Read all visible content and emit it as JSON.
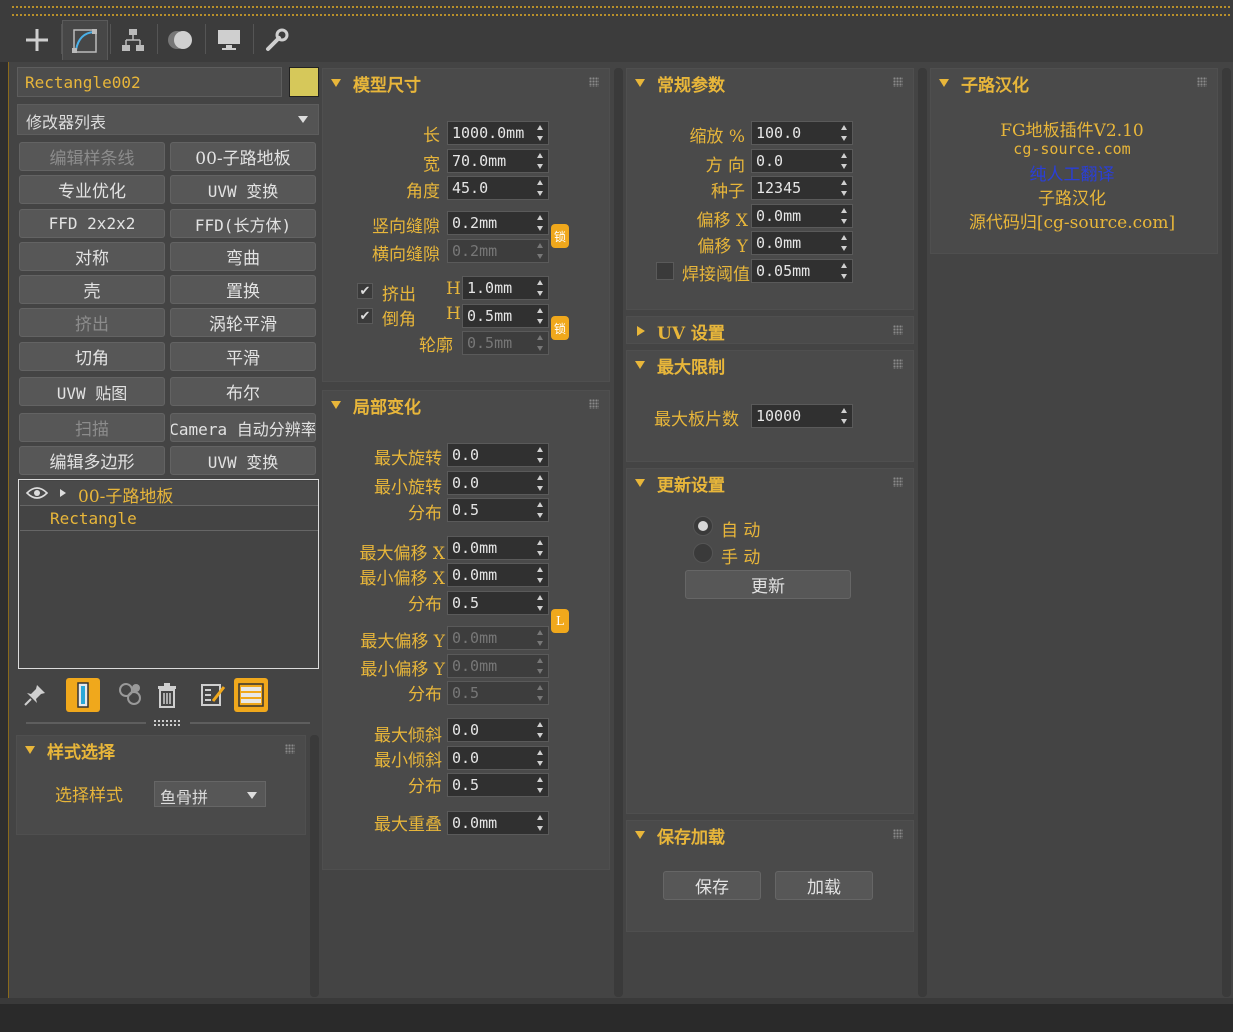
{
  "toolbar": {
    "tabs": [
      {
        "name": "create-tab",
        "icon": "plus-icon"
      },
      {
        "name": "modify-tab",
        "icon": "modify-curve-icon"
      },
      {
        "name": "hierarchy-tab",
        "icon": "hierarchy-icon"
      },
      {
        "name": "motion-tab",
        "icon": "motion-circle-icon"
      },
      {
        "name": "display-tab",
        "icon": "monitor-icon"
      },
      {
        "name": "utilities-tab",
        "icon": "wrench-icon"
      }
    ]
  },
  "object": {
    "name": "Rectangle002",
    "color": "#d6c85a"
  },
  "modifier_list": {
    "label": "修改器列表"
  },
  "modifier_buttons": [
    "编辑样条线",
    "00-子路地板",
    "专业优化",
    "UVW 变换",
    "FFD 2x2x2",
    "FFD(长方体)",
    "对称",
    "弯曲",
    "壳",
    "置换",
    "挤出",
    "涡轮平滑",
    "切角",
    "平滑",
    "UVW 贴图",
    "布尔",
    "扫描",
    "Camera 自动分辨率",
    "编辑多边形",
    "UVW 变换"
  ],
  "stack": {
    "items": [
      "00-子路地板",
      "Rectangle"
    ]
  },
  "style_select": {
    "title": "样式选择",
    "label": "选择样式",
    "value": "鱼骨拼"
  },
  "model_size": {
    "title": "模型尺寸",
    "length_label": "长",
    "length": "1000.0mm",
    "width_label": "宽",
    "width": "70.0mm",
    "angle_label": "角度",
    "angle": "45.0",
    "vgap_label": "竖向缝隙",
    "vgap": "0.2mm",
    "hgap_label": "横向缝隙",
    "hgap": "0.2mm",
    "lock1": "锁",
    "extrude_label": "挤出",
    "extrude_h": "H",
    "extrude": "1.0mm",
    "chamfer_label": "倒角",
    "chamfer_h": "H",
    "chamfer": "0.5mm",
    "lock2": "锁",
    "outline_label": "轮廓",
    "outline": "0.5mm"
  },
  "local_change": {
    "title": "局部变化",
    "max_rot_label": "最大旋转",
    "max_rot": "0.0",
    "min_rot_label": "最小旋转",
    "min_rot": "0.0",
    "dist1_label": "分布",
    "dist1": "0.5",
    "max_offx_label": "最大偏移 X",
    "max_offx": "0.0mm",
    "min_offx_label": "最小偏移 X",
    "min_offx": "0.0mm",
    "dist2_label": "分布",
    "dist2": "0.5",
    "lock_l": "L",
    "max_offy_label": "最大偏移 Y",
    "max_offy": "0.0mm",
    "min_offy_label": "最小偏移 Y",
    "min_offy": "0.0mm",
    "dist3_label": "分布",
    "dist3": "0.5",
    "max_tilt_label": "最大倾斜",
    "max_tilt": "0.0",
    "min_tilt_label": "最小倾斜",
    "min_tilt": "0.0",
    "dist4_label": "分布",
    "dist4": "0.5",
    "max_overlap_label": "最大重叠",
    "max_overlap": "0.0mm"
  },
  "general": {
    "title": "常规参数",
    "scale_label": "缩放 %",
    "scale": "100.0",
    "dir_label": "方 向",
    "dir": "0.0",
    "seed_label": "种子",
    "seed": "12345",
    "offx_label": "偏移 X",
    "offx": "0.0mm",
    "offy_label": "偏移 Y",
    "offy": "0.0mm",
    "weld_label": "焊接阈值",
    "weld": "0.05mm"
  },
  "uv": {
    "title": "UV 设置"
  },
  "max_limit": {
    "title": "最大限制",
    "label": "最大板片数",
    "value": "10000"
  },
  "update": {
    "title": "更新设置",
    "auto": "自 动",
    "manual": "手 动",
    "button": "更新"
  },
  "save_load": {
    "title": "保存加载",
    "save": "保存",
    "load": "加载"
  },
  "info": {
    "title": "子路汉化",
    "line1": "FG地板插件V2.10",
    "line2": "cg-source.com",
    "line3": "纯人工翻译",
    "line4": "子路汉化",
    "line5": "源代码归[cg-source.com]"
  },
  "colors": {
    "accent": "#e8b63a",
    "highlight": "#f0a81c",
    "link_blue": "#2a3fd8"
  }
}
